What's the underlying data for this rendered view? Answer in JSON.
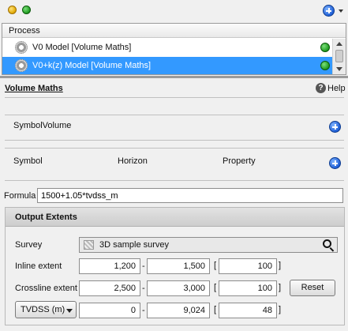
{
  "process_panel": {
    "header": "Process",
    "items": [
      {
        "label": "V0 Model [Volume Maths]",
        "selected": false
      },
      {
        "label": "V0+k(z) Model [Volume Maths]",
        "selected": true
      }
    ]
  },
  "volume_maths": {
    "title": "Volume Maths",
    "help_label": "Help",
    "symbol_volume_label": "SymbolVolume",
    "columns": {
      "symbol": "Symbol",
      "horizon": "Horizon",
      "property": "Property"
    },
    "formula_label": "Formula",
    "formula_value": "1500+1.05*tvdss_m"
  },
  "output_extents": {
    "title": "Output Extents",
    "survey_label": "Survey",
    "survey_value": "3D sample survey",
    "inline": {
      "label": "Inline extent",
      "from": "1,200",
      "to": "1,500",
      "step": "100"
    },
    "crossline": {
      "label": "Crossline extent",
      "from": "2,500",
      "to": "3,000",
      "step": "100"
    },
    "depth": {
      "unit": "TVDSS (m)",
      "from": "0",
      "to": "9,024",
      "step": "48"
    },
    "reset_label": "Reset",
    "dash": "-",
    "open_bracket": "[",
    "close_bracket": "]"
  },
  "icons": {
    "status_yellow": "yellow-status-dot",
    "status_green": "green-status-dot",
    "add": "add-plus-icon",
    "help": "help-icon",
    "search": "magnifier-icon",
    "process": "gear-icon"
  },
  "colors": {
    "selection": "#3399ff",
    "add_blue": "#1f5fd6",
    "status_green": "#1f9a1f",
    "status_yellow": "#e0a800"
  }
}
